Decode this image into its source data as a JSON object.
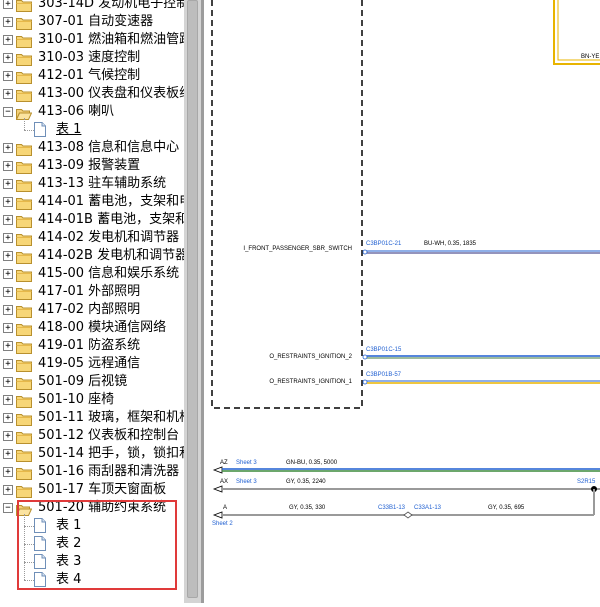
{
  "tree": {
    "items": [
      {
        "code": "303-14D",
        "title": "发动机电子控制",
        "expanded": false
      },
      {
        "code": "307-01",
        "title": "自动变速器",
        "expanded": false
      },
      {
        "code": "310-01",
        "title": "燃油箱和燃油管路",
        "expanded": false
      },
      {
        "code": "310-03",
        "title": "速度控制",
        "expanded": false
      },
      {
        "code": "412-01",
        "title": "气候控制",
        "expanded": false
      },
      {
        "code": "413-00",
        "title": "仪表盘和仪表板组件",
        "expanded": false
      },
      {
        "code": "413-06",
        "title": "喇叭",
        "expanded": true,
        "children": [
          "表 1"
        ]
      },
      {
        "code": "413-08",
        "title": "信息和信息中心",
        "expanded": false
      },
      {
        "code": "413-09",
        "title": "报警装置",
        "expanded": false
      },
      {
        "code": "413-13",
        "title": "驻车辅助系统",
        "expanded": false
      },
      {
        "code": "414-01",
        "title": "蓄电池，支架和电缆",
        "expanded": false
      },
      {
        "code": "414-01B",
        "title": "蓄电池，支架和电缆",
        "expanded": false
      },
      {
        "code": "414-02",
        "title": "发电机和调节器",
        "expanded": false
      },
      {
        "code": "414-02B",
        "title": "发电机和调节器",
        "expanded": false
      },
      {
        "code": "415-00",
        "title": "信息和娱乐系统",
        "expanded": false
      },
      {
        "code": "417-01",
        "title": "外部照明",
        "expanded": false
      },
      {
        "code": "417-02",
        "title": "内部照明",
        "expanded": false
      },
      {
        "code": "418-00",
        "title": "模块通信网络",
        "expanded": false
      },
      {
        "code": "419-01",
        "title": "防盗系统",
        "expanded": false
      },
      {
        "code": "419-05",
        "title": "远程通信",
        "expanded": false
      },
      {
        "code": "501-09",
        "title": "后视镜",
        "expanded": false
      },
      {
        "code": "501-10",
        "title": "座椅",
        "expanded": false
      },
      {
        "code": "501-11",
        "title": "玻璃，框架和机构",
        "expanded": false
      },
      {
        "code": "501-12",
        "title": "仪表板和控制台",
        "expanded": false
      },
      {
        "code": "501-14",
        "title": "把手，锁，锁扣和进入系统",
        "expanded": false
      },
      {
        "code": "501-16",
        "title": "雨刮器和清洗器",
        "expanded": false
      },
      {
        "code": "501-17",
        "title": "车顶天窗面板",
        "expanded": false
      },
      {
        "code": "501-20",
        "title": "辅助约束系统",
        "expanded": true,
        "children": [
          "表 1",
          "表 2",
          "表 3",
          "表 4"
        ]
      }
    ]
  },
  "diagram": {
    "signals": [
      {
        "name": "I_FRONT_PASSENGER_SBR_SWITCH",
        "pin": "C3BP01C-21",
        "wire": "BU-WH,  0.35,  1835"
      },
      {
        "name": "O_RESTRAINTS_IGNITION_2",
        "pin": "C3BP01C-15",
        "wire": ""
      },
      {
        "name": "O_RESTRAINTS_IGNITION_1",
        "pin": "C3BP01B-57",
        "wire": ""
      }
    ],
    "top_right_label": "BN-YE",
    "bus_lines": [
      {
        "tag": "AZ",
        "sheet": "Sheet 3",
        "wire": "GN-BU,  0.35,  5000",
        "end": ""
      },
      {
        "tag": "AX",
        "sheet": "Sheet 3",
        "wire": "GY,  0.35,  2240",
        "end": "S2R15"
      },
      {
        "tag": "A",
        "sheet": "Sheet 2",
        "wire": "GY,  0.35,  330",
        "mid1": "C33B1-13",
        "mid2": "C33A1-13",
        "wire2": "GY,  0.35,  695"
      }
    ]
  },
  "colors": {
    "highlight": "#e03a3a",
    "wire_blue": "#1f5fd1",
    "wire_yellow": "#e8b400",
    "wire_gray": "#9a9a9a"
  }
}
